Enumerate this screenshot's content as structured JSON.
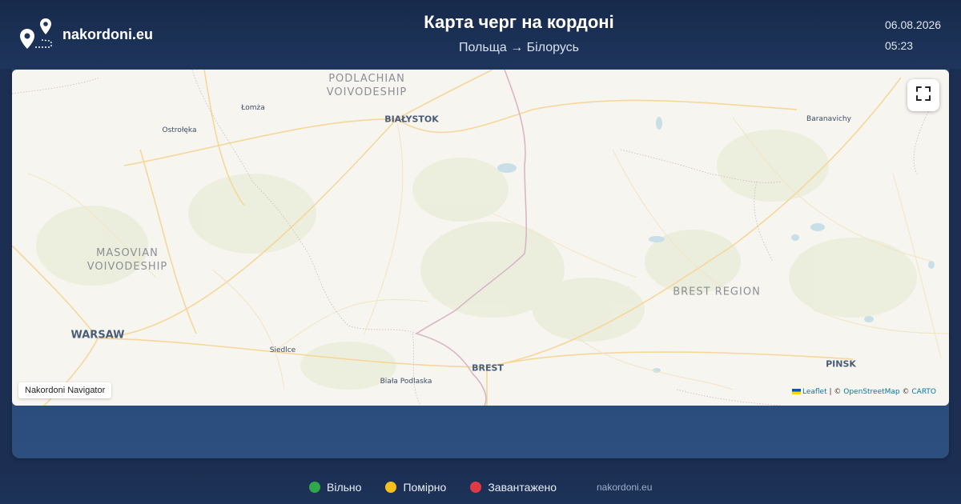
{
  "header": {
    "site_name": "nakordoni.eu",
    "title": "Карта черг на кордоні",
    "subtitle": "Польща → Білорусь",
    "date": "06.08.2026",
    "time": "05:23",
    "logo_icon": "map-pins-route-icon"
  },
  "map": {
    "fullscreen_icon": "fullscreen-icon",
    "badge": "Nakordoni Navigator",
    "attribution": {
      "leaflet": "Leaflet",
      "separator": " | © ",
      "osm": "OpenStreetMap",
      "copy": " © ",
      "carto": "CARTO"
    },
    "labels": {
      "podlachian": "PODLACHIAN\nVOIVODESHIP",
      "masovian": "MASOVIAN\nVOIVODESHIP",
      "brest_region": "BREST REGION",
      "bialystok": "BIAŁYSTOK",
      "warsaw": "WARSAW",
      "brest": "BREST",
      "pinsk": "PINSK",
      "lomza": "Łomża",
      "ostroleka": "Ostrołęka",
      "baranavichy": "Baranavichy",
      "siedlce": "Siedlce",
      "biala": "Biała Podlaska"
    }
  },
  "legend": [
    {
      "label": "Вільно",
      "color": "#2ea84a"
    },
    {
      "label": "Помірно",
      "color": "#f6c21a"
    },
    {
      "label": "Завантажено",
      "color": "#e03a45"
    }
  ],
  "footer": {
    "site": "nakordoni.eu"
  },
  "colors": {
    "accent": "#1e355d",
    "map_bg": "#f7f5ef"
  }
}
